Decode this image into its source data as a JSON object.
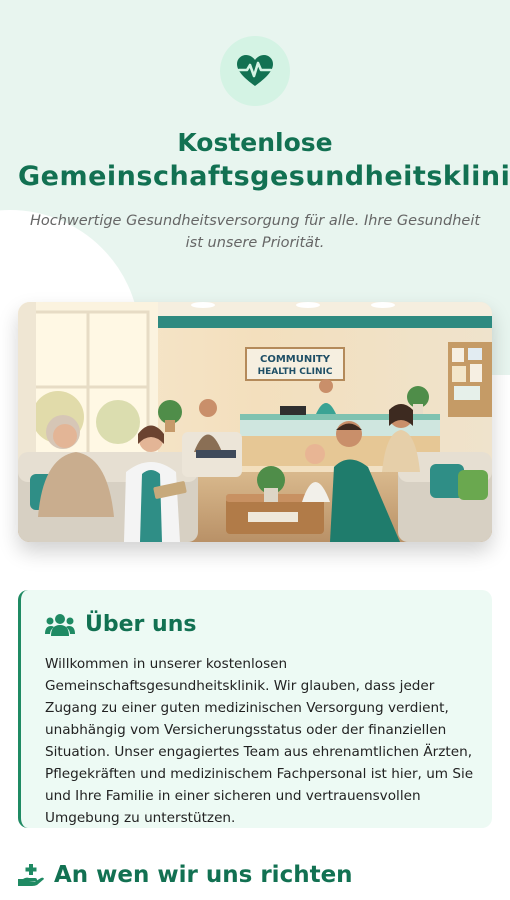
{
  "hero": {
    "title_line1": "Kostenlose",
    "title_line2": "Gemeinschaftsgesundheitsklinik",
    "subtitle": "Hochwertige Gesundheitsversorgung für alle. Ihre Gesundheit ist unsere Priorität.",
    "logo_icon": "heart-pulse-icon"
  },
  "image": {
    "sign_text_line1": "COMMUNITY",
    "sign_text_line2": "HEALTH CLINIC"
  },
  "about": {
    "icon": "users-icon",
    "heading": "Über uns",
    "text": "Willkommen in unserer kostenlosen Gemeinschaftsgesundheitsklinik. Wir glauben, dass jeder Zugang zu einer guten medizinischen Versorgung verdient, unabhängig vom Versicherungsstatus oder der finanziellen Situation. Unser engagiertes Team aus ehrenamtlichen Ärzten, Pflegekräften und medizinischem Fachpersonal ist hier, um Sie und Ihre Familie in einer sicheren und vertrauensvollen Umgebung zu unterstützen."
  },
  "target": {
    "icon": "hand-holding-medical-icon",
    "heading": "An wen wir uns richten"
  },
  "colors": {
    "primary": "#127152",
    "hero_bg": "#e8f5ef",
    "card_bg": "#edfaf4",
    "accent": "#1f8a63"
  }
}
